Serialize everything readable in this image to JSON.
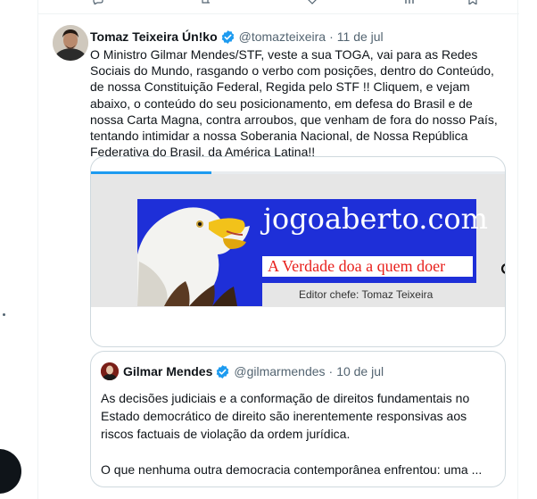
{
  "tweet": {
    "author_name": "Tomaz Teixeira Ún!ko",
    "handle": "@tomazteixeira",
    "separator": "·",
    "date": "11 de jul",
    "text": "O Ministro Gilmar Mendes/STF, veste a sua TOGA, vai para as Redes Sociais do Mundo, rasgando o verbo com posições, dentro do Conteúdo, de nossa Constituição Federal, Regida pelo STF !! Cliquem, e vejam abaixo, o conteúdo do seu posicionamento, em defesa do Brasil e de nossa Carta Magna, contra arroubos, que venham de fora do nosso País, tentando intimidar a nossa Soberania Nacional, de Nossa República Federativa do Brasil, da América Latina!!"
  },
  "link_card": {
    "site_title": "jogoaberto.com",
    "tagline": "A Verdade doa a quem doer",
    "editor_line": "Editor chefe: Tomaz Teixeira",
    "loading_progress": 0.29
  },
  "quote": {
    "author_name": "Gilmar Mendes",
    "handle": "@gilmarmendes",
    "separator": "·",
    "date": "10 de jul",
    "paragraph_1": "As decisões judiciais e a conformação de direitos fundamentais no Estado democrático de direito são inerentemente responsivas aos riscos factuais de violação da ordem jurídica.",
    "paragraph_2": "O que nenhuma outra democracia contemporânea enfrentou: uma ..."
  },
  "icons": {
    "verified": "verified-badge-icon",
    "more": "more-options-icon",
    "card_next": "chevron-right-icon"
  },
  "colors": {
    "accent": "#1d9bf0",
    "text_primary": "#0f1419",
    "text_secondary": "#536471",
    "border": "#cfd9de",
    "banner_blue": "#1e2fd8",
    "tagline_red": "#e8201c"
  }
}
